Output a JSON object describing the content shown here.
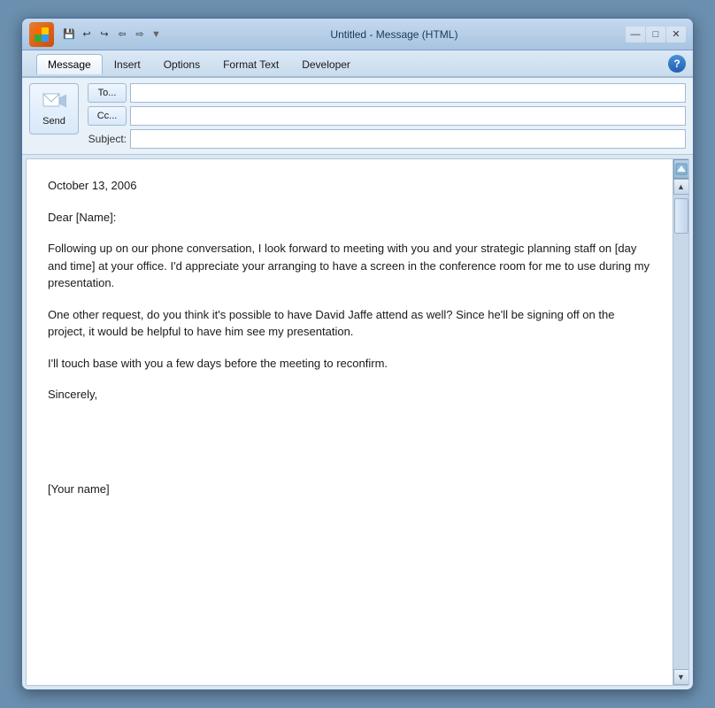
{
  "titleBar": {
    "logo": "O",
    "title": "Untitled - Message (HTML)",
    "quickAccess": [
      "💾",
      "↩",
      "↪",
      "→",
      "→"
    ],
    "windowControls": [
      "—",
      "□",
      "✕"
    ]
  },
  "ribbon": {
    "tabs": [
      "Message",
      "Insert",
      "Options",
      "Format Text",
      "Developer"
    ],
    "activeTab": "Message",
    "helpLabel": "?"
  },
  "header": {
    "sendLabel": "Send",
    "toLabel": "To...",
    "ccLabel": "Cc...",
    "subjectLabel": "Subject:",
    "toValue": "",
    "ccValue": "",
    "subjectValue": ""
  },
  "emailBody": {
    "date": "October 13, 2006",
    "greeting": "Dear [Name]:",
    "paragraph1": "Following up on our phone conversation, I look forward to meeting with you and your strategic planning staff on [day and time] at your office. I'd appreciate your arranging to have a screen in the conference room for me to use during my presentation.",
    "paragraph2": "One other request, do you think it's possible to have David Jaffe attend as well? Since he'll be signing off on the project, it would be helpful to have him see my presentation.",
    "paragraph3": "I'll touch base with you a few days before the meeting to reconfirm.",
    "closing": "Sincerely,",
    "signature": "[Your name]"
  },
  "scrollbar": {
    "upArrow": "▲",
    "downArrow": "▼"
  }
}
